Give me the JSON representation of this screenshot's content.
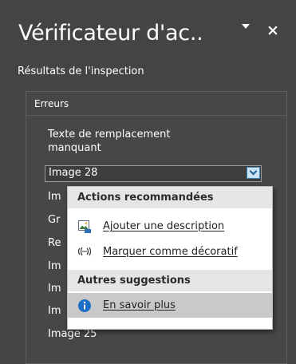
{
  "pane": {
    "title": "Vérificateur d'ac..",
    "close_glyph": "×"
  },
  "results_label": "Résultats de l'inspection",
  "errors_group": {
    "title": "Erreurs",
    "category_label": "Texte de remplacement manquant",
    "selected_item": "Image 28",
    "items": [
      {
        "label": "Im"
      },
      {
        "label": "Gr"
      },
      {
        "label": "Re"
      },
      {
        "label": "Im"
      },
      {
        "label": "Im"
      },
      {
        "label": "Im"
      },
      {
        "label": "Image 25"
      }
    ]
  },
  "context_menu": {
    "recommended_header": "Actions recommandées",
    "add_description": "Ajouter une description",
    "mark_decorative": "Marquer comme décoratif",
    "other_header": "Autres suggestions",
    "learn_more": "En savoir plus"
  },
  "icons": {
    "options": "chevron-down-icon",
    "close": "close-icon",
    "dropdown": "chevron-down-icon",
    "add_description": "image-description-icon",
    "mark_decorative": "decorative-icon",
    "learn_more": "info-icon"
  },
  "colors": {
    "pane_bg": "#444444",
    "menu_bg": "#ffffff",
    "menu_header_bg": "#e5e5e5",
    "menu_hover_bg": "#c9c9c9",
    "info_blue": "#1e6fc7",
    "dropdown_accent": "#cce4f7"
  }
}
